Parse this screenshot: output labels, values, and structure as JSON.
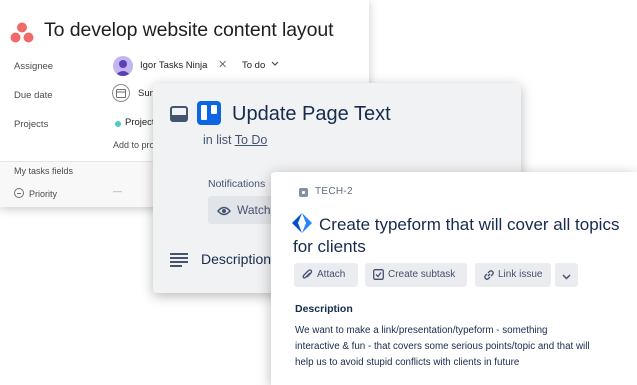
{
  "asana": {
    "title": "To develop website content layout",
    "fields": {
      "assignee_label": "Assignee",
      "due_date_label": "Due date",
      "projects_label": "Projects"
    },
    "assignee_name": "Igor Tasks Ninja",
    "status": "To do",
    "due_date_value": "Sun",
    "project_value": "Project",
    "add_to_projects": "Add to pro",
    "my_tasks_fields": "My tasks fields",
    "priority_label": "Priority",
    "priority_value": "—",
    "colors": {
      "logo": "#f06a6a",
      "project_dot": "#4ecbc4"
    },
    "icons": [
      "asana-logo-icon",
      "avatar",
      "close-icon",
      "chevron-down-icon",
      "calendar-icon",
      "priority-icon"
    ]
  },
  "trello": {
    "title": "Update Page Text",
    "in_list_prefix": "in list",
    "list_name": "To Do",
    "notifications_label": "Notifications",
    "watch_label": "Watch",
    "description_label": "Description",
    "colors": {
      "logo": "#0c66e4",
      "background": "#f1f2f4"
    },
    "icons": [
      "card-icon",
      "trello-logo-icon",
      "eye-icon",
      "description-icon"
    ]
  },
  "jira": {
    "issue_key": "TECH-2",
    "title": "Create typeform that will cover all topics for clients",
    "buttons": {
      "attach": "Attach",
      "create_subtask": "Create subtask",
      "link_issue": "Link issue"
    },
    "description_label": "Description",
    "description_lines": [
      "We want to make a link/presentation/typeform - something",
      "interactive & fun - that covers some serious points/topic and that will",
      "help us to avoid stupid conflicts with clients in future"
    ],
    "colors": {
      "logo": "#2684ff"
    },
    "icons": [
      "issue-type-icon",
      "jira-logo-icon",
      "paperclip-icon",
      "subtask-icon",
      "link-icon",
      "chevron-down-icon"
    ]
  }
}
